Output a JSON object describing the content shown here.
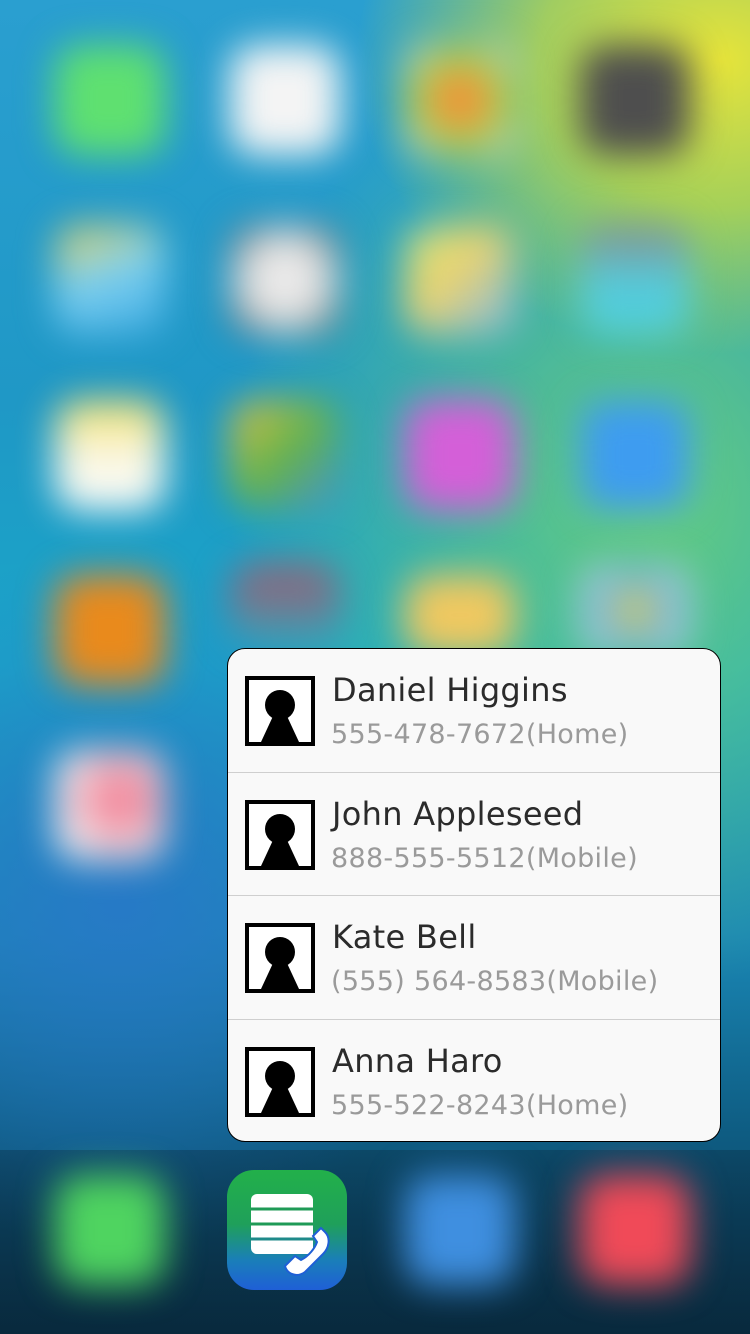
{
  "home_screen": {
    "state": "blurred",
    "quick_action_app_icon": "contacts-dialer-app-icon"
  },
  "quick_actions": {
    "items": [
      {
        "name": "Daniel Higgins",
        "phone": "555-478-7672(Home)",
        "icon": "contact-avatar-icon"
      },
      {
        "name": "John Appleseed",
        "phone": "888-555-5512(Mobile)",
        "icon": "contact-avatar-icon"
      },
      {
        "name": "Kate Bell",
        "phone": "(555) 564-8583(Mobile)",
        "icon": "contact-avatar-icon"
      },
      {
        "name": "Anna Haro",
        "phone": "555-522-8243(Home)",
        "icon": "contact-avatar-icon"
      }
    ]
  },
  "colors": {
    "popup_background": "#f9f9f9",
    "name_text": "#2b2b2b",
    "phone_text": "#9a9a9a",
    "app_icon_top": "#22b04a",
    "app_icon_bottom": "#1f5fd6"
  }
}
